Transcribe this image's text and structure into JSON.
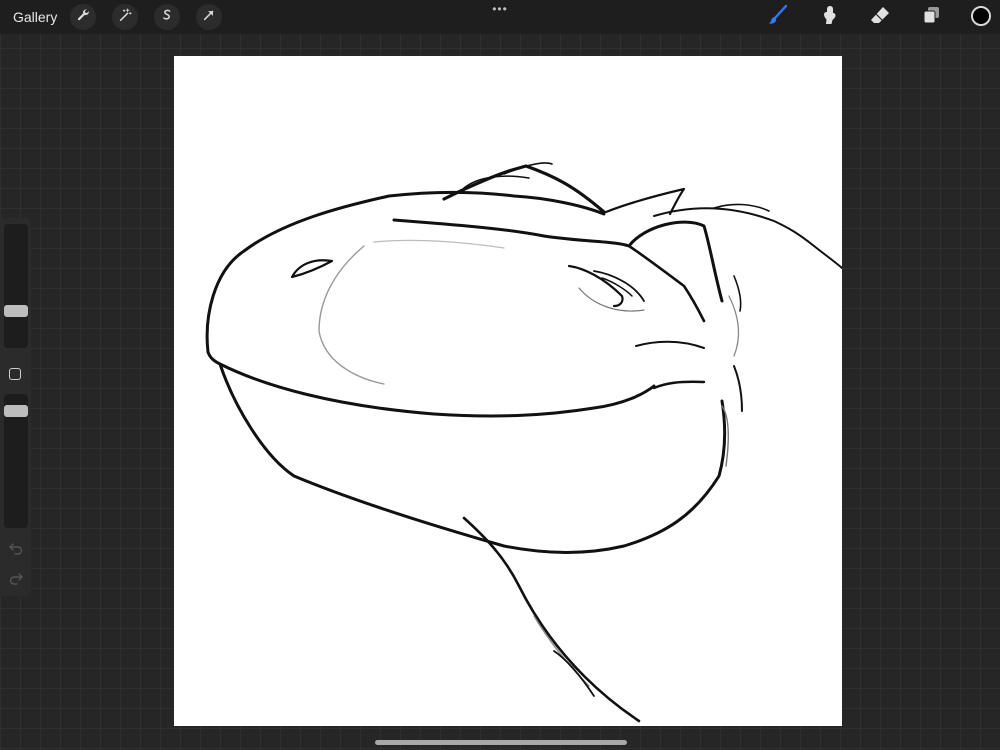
{
  "topbar": {
    "gallery_label": "Gallery",
    "left_tools": [
      {
        "name": "actions",
        "icon": "wrench-icon"
      },
      {
        "name": "adjustments",
        "icon": "magic-wand-icon"
      },
      {
        "name": "selection",
        "icon": "selection-s-icon"
      },
      {
        "name": "transform",
        "icon": "arrow-cursor-icon"
      }
    ],
    "more_label": "•••",
    "right_tools": [
      {
        "name": "brush",
        "icon": "brush-icon",
        "active": true
      },
      {
        "name": "smudge",
        "icon": "smudge-icon",
        "active": false
      },
      {
        "name": "eraser",
        "icon": "eraser-icon",
        "active": false
      },
      {
        "name": "layers",
        "icon": "layers-icon",
        "active": false
      }
    ],
    "current_color": "#000000",
    "active_color": "#2f7bf5"
  },
  "sidebar": {
    "brush_size_level": 0.3,
    "brush_opacity_level": 1.0,
    "undo_icon": "undo-arrow-icon",
    "redo_icon": "redo-arrow-icon"
  },
  "canvas": {
    "background": "#ffffff",
    "subject": "line-art-dinosaur-head"
  }
}
